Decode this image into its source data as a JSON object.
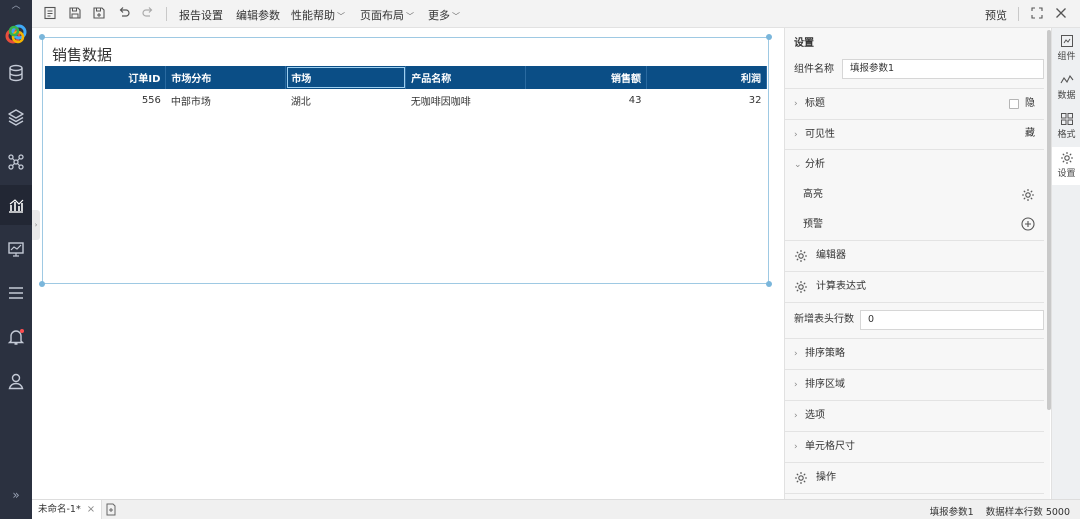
{
  "toolbar": {
    "menus": [
      {
        "label": "报告设置",
        "caret": false
      },
      {
        "label": "编辑参数",
        "caret": false
      },
      {
        "label": "性能帮助",
        "caret": true
      },
      {
        "label": "页面布局",
        "caret": true
      },
      {
        "label": "更多",
        "caret": true
      }
    ],
    "preview_label": "预览"
  },
  "report": {
    "title": "销售数据",
    "columns": [
      "订单ID",
      "市场分布",
      "市场",
      "产品名称",
      "销售额",
      "利润"
    ],
    "selected_column_index": 2,
    "rows": [
      [
        "556",
        "中部市场",
        "湖北",
        "无咖啡因咖啡",
        "43",
        "32"
      ]
    ]
  },
  "status": {
    "sheet_tab": "未命名-1*",
    "close_glyph": "×",
    "component": "填报参数1",
    "sample_rows": "数据样本行数 5000"
  },
  "panel": {
    "title": "设置",
    "component_name_label": "组件名称",
    "component_name_value": "填报参数1",
    "title_section": "标题",
    "hide_label": "隐藏",
    "hide_checked": false,
    "visibility": "可见性",
    "analysis": "分析",
    "highlight": "高亮",
    "warning": "预警",
    "editor": "编辑器",
    "calc_expr": "计算表达式",
    "header_rows_label": "新增表头行数",
    "header_rows_value": "0",
    "sort_strategy": "排序策略",
    "sort_area": "排序区域",
    "options": "选项",
    "cell_size": "单元格尺寸",
    "operation": "操作"
  },
  "rail": {
    "items": [
      "组件",
      "数据",
      "格式",
      "设置"
    ],
    "active_index": 3
  },
  "colors": {
    "nav_bg": "#2b3140",
    "header_bg": "#0b4e86",
    "accent": "#7ab6db"
  },
  "icons": {
    "nav": [
      "logo-icon",
      "database-icon",
      "layers-icon",
      "network-icon",
      "chart-icon",
      "monitor-icon",
      "menu-icon",
      "bell-icon",
      "user-icon"
    ],
    "toolbar": [
      "new-icon",
      "save-icon",
      "save-as-icon",
      "undo-icon",
      "redo-icon",
      "fullscreen-icon",
      "close-icon"
    ]
  }
}
